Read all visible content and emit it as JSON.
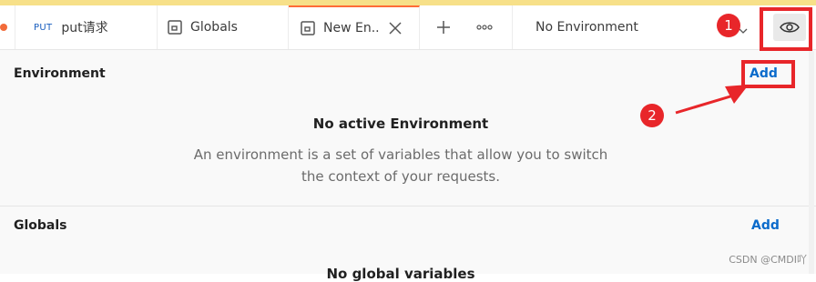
{
  "tabs": [
    {
      "method": "PUT",
      "label": "put请求",
      "icon": "request-icon",
      "has_unsaved_dot": true
    },
    {
      "label": "Globals",
      "icon": "environment-icon"
    },
    {
      "label": "New En...",
      "icon": "environment-icon",
      "active": true
    }
  ],
  "tabbar": {
    "new_tab_icon": "plus-icon",
    "more_icon": "more-horizontal-icon",
    "environment_selector": "No Environment",
    "environment_quick_look_icon": "eye-icon"
  },
  "environment_section": {
    "title": "Environment",
    "add_label": "Add",
    "empty_title": "No active Environment",
    "empty_description": "An environment is a set of variables that allow you to switch the context of your requests."
  },
  "globals_section": {
    "title": "Globals",
    "add_label": "Add",
    "empty_title": "No global variables"
  },
  "annotations": {
    "badge_1": "1",
    "badge_2": "2"
  },
  "watermark": "CSDN @CMDI吖",
  "colors": {
    "accent_orange": "#ff6c37",
    "link_blue": "#0b6bcb",
    "annotation_red": "#e8262a",
    "top_stripe": "#f7e089"
  }
}
